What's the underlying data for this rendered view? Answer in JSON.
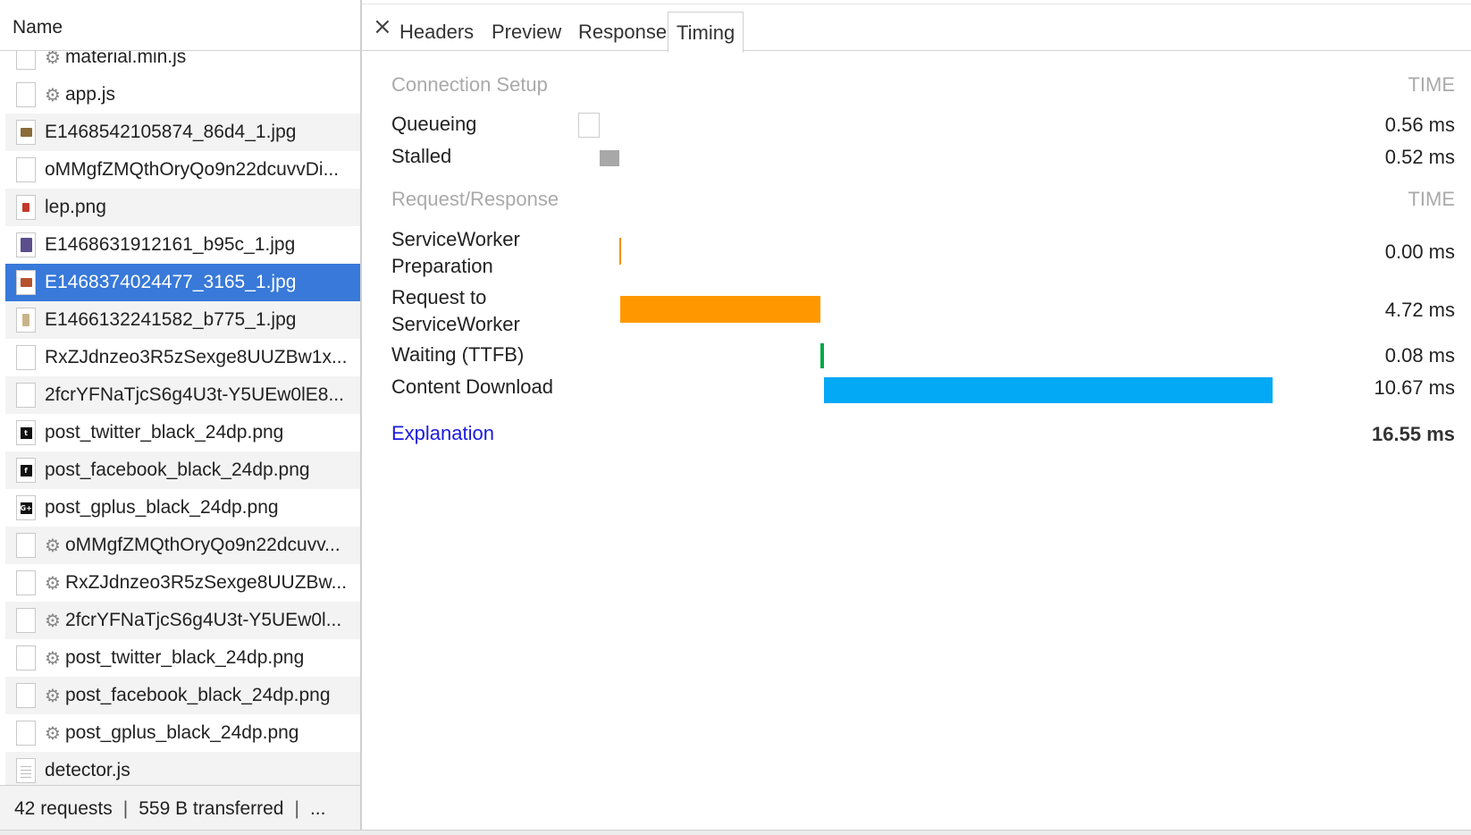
{
  "network": {
    "column_header": "Name",
    "partial_top_file": "material.min.js",
    "files": [
      {
        "name": "app.js",
        "icon": "gear-icon"
      },
      {
        "name": "E1468542105874_86d4_1.jpg",
        "icon": "image-thumbnail-icon"
      },
      {
        "name": "oMMgfZMQthOryQo9n22dcuvvDi...",
        "icon": "blank-file-icon"
      },
      {
        "name": "lep.png",
        "icon": "image-thumbnail-icon"
      },
      {
        "name": "E1468631912161_b95c_1.jpg",
        "icon": "image-thumbnail-icon"
      },
      {
        "name": "E1468374024477_3165_1.jpg",
        "icon": "image-thumbnail-icon",
        "selected": true
      },
      {
        "name": "E1466132241582_b775_1.jpg",
        "icon": "image-thumbnail-icon"
      },
      {
        "name": "RxZJdnzeo3R5zSexge8UUZBw1x...",
        "icon": "blank-file-icon"
      },
      {
        "name": "2fcrYFNaTjcS6g4U3t-Y5UEw0lE8...",
        "icon": "blank-file-icon"
      },
      {
        "name": "post_twitter_black_24dp.png",
        "icon": "twitter-icon"
      },
      {
        "name": "post_facebook_black_24dp.png",
        "icon": "facebook-icon"
      },
      {
        "name": "post_gplus_black_24dp.png",
        "icon": "gplus-icon"
      },
      {
        "name": "oMMgfZMQthOryQo9n22dcuvv...",
        "icon": "gear-icon"
      },
      {
        "name": "RxZJdnzeo3R5zSexge8UUZBw...",
        "icon": "gear-icon"
      },
      {
        "name": "2fcrYFNaTjcS6g4U3t-Y5UEw0l...",
        "icon": "gear-icon"
      },
      {
        "name": "post_twitter_black_24dp.png",
        "icon": "gear-icon"
      },
      {
        "name": "post_facebook_black_24dp.png",
        "icon": "gear-icon"
      },
      {
        "name": "post_gplus_black_24dp.png",
        "icon": "gear-icon"
      },
      {
        "name": "detector.js",
        "icon": "script-file-icon"
      }
    ],
    "footer": {
      "requests": "42 requests",
      "transferred": "559 B transferred",
      "separator": "|",
      "more": "..."
    }
  },
  "details": {
    "close_label": "×",
    "tabs": [
      "Headers",
      "Preview",
      "Response",
      "Timing"
    ],
    "active_tab": "Timing"
  },
  "timing": {
    "connection_setup": {
      "heading": "Connection Setup",
      "time_heading": "TIME",
      "rows": [
        {
          "label": "Queueing",
          "value": "0.56 ms"
        },
        {
          "label": "Stalled",
          "value": "0.52 ms"
        }
      ]
    },
    "request_response": {
      "heading": "Request/Response",
      "time_heading": "TIME",
      "rows": [
        {
          "label_line1": "ServiceWorker",
          "label_line2": "Preparation",
          "value": "0.00 ms"
        },
        {
          "label_line1": "Request to",
          "label_line2": "ServiceWorker",
          "value": "4.72 ms"
        },
        {
          "label": "Waiting (TTFB)",
          "value": "0.08 ms"
        },
        {
          "label": "Content Download",
          "value": "10.67 ms"
        }
      ]
    },
    "explanation_link": "Explanation",
    "total": "16.55 ms",
    "colors": {
      "queueing": "#ffffff",
      "stalled": "#a8a8a8",
      "sw_preparation": "#f29100",
      "request_to_sw": "#ff9800",
      "waiting": "#00a846",
      "content_download": "#03a9f4",
      "selected_row": "#3879d9"
    }
  }
}
